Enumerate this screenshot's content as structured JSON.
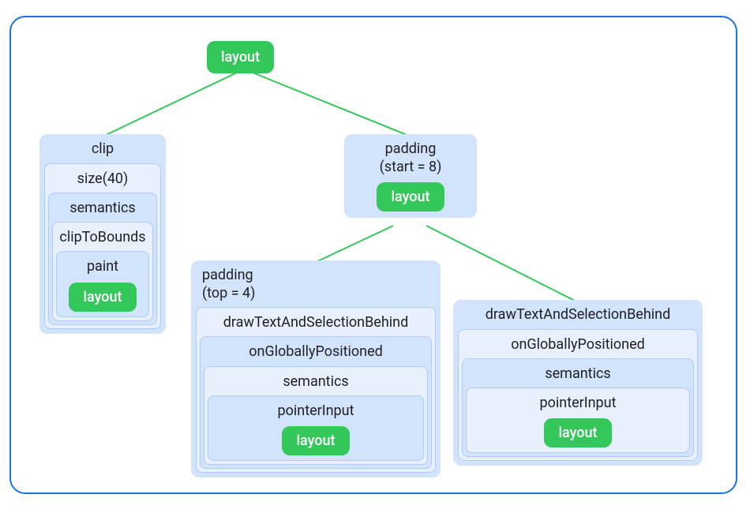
{
  "root": {
    "label": "layout"
  },
  "left": {
    "head": "clip",
    "levels": [
      "size(40)",
      "semantics",
      "clipToBounds",
      "paint"
    ],
    "leaf": "layout"
  },
  "mid": {
    "headLine1": "padding",
    "headLine2": "(start = 8)",
    "leaf": "layout"
  },
  "bottomLeft": {
    "headLine1": "padding",
    "headLine2": "(top = 4)",
    "levels": [
      "drawTextAndSelectionBehind",
      "onGloballyPositioned",
      "semantics",
      "pointerInput"
    ],
    "leaf": "layout"
  },
  "bottomRight": {
    "head": "drawTextAndSelectionBehind",
    "levels": [
      "onGloballyPositioned",
      "semantics",
      "pointerInput"
    ],
    "leaf": "layout"
  },
  "colors": {
    "frameBorder": "#1a73e8",
    "nodeLight": "#e8f0fe",
    "nodeMid": "#d2e3fc",
    "nodeBorder": "#aecbfa",
    "pill": "#34c759",
    "edge": "#34c759"
  }
}
